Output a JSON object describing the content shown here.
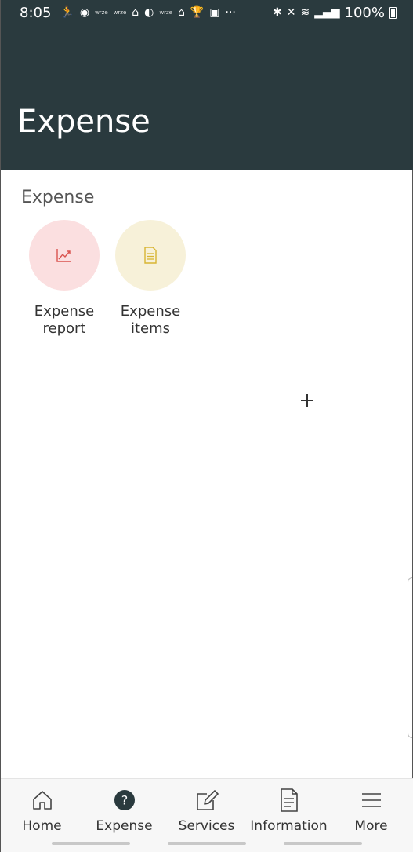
{
  "status_bar": {
    "time": "8:05",
    "battery_percent": "100%",
    "tiny_label": "wrze",
    "dots": "···"
  },
  "header": {
    "title": "Expense"
  },
  "section": {
    "title": "Expense"
  },
  "tiles": [
    {
      "label_line1": "Expense",
      "label_line2": "report",
      "icon": "chart-line-icon",
      "circle_color": "#fbdfe0",
      "icon_color": "#d9534f"
    },
    {
      "label_line1": "Expense",
      "label_line2": "items",
      "icon": "document-icon",
      "circle_color": "#f7f1d9",
      "icon_color": "#d8b532"
    }
  ],
  "tabs": [
    {
      "label": "Home",
      "icon": "home-icon"
    },
    {
      "label": "Expense",
      "icon": "question-circle-icon",
      "active": true
    },
    {
      "label": "Services",
      "icon": "edit-icon"
    },
    {
      "label": "Information",
      "icon": "document-icon"
    },
    {
      "label": "More",
      "icon": "menu-icon"
    }
  ],
  "colors": {
    "header_bg": "#2a3a3e",
    "active_tab": "#2a3a3e"
  }
}
